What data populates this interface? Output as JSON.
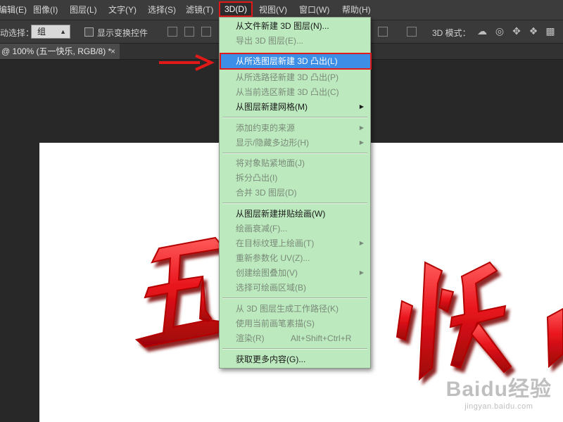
{
  "menubar": {
    "items": [
      {
        "label": "编辑(E)"
      },
      {
        "label": "图像(I)"
      },
      {
        "label": "图层(L)"
      },
      {
        "label": "文字(Y)"
      },
      {
        "label": "选择(S)"
      },
      {
        "label": "滤镜(T)"
      },
      {
        "label": "3D(D)"
      },
      {
        "label": "视图(V)"
      },
      {
        "label": "窗口(W)"
      },
      {
        "label": "帮助(H)"
      }
    ]
  },
  "options_bar": {
    "auto_select_label": "自动选择：",
    "auto_select_value": "组",
    "show_transform_label": "显示变换控件",
    "mode_label": "3D 模式："
  },
  "document_tab": {
    "title": "@ 100% (五一快乐, RGB/8) *"
  },
  "menu_3d": {
    "items": [
      {
        "label": "从文件新建 3D 图层(N)...",
        "enabled": true,
        "submenu": false
      },
      {
        "label": "导出 3D 图层(E)...",
        "enabled": false,
        "submenu": false
      },
      {
        "label": "从所选图层新建 3D 凸出(L)",
        "enabled": true,
        "submenu": false,
        "highlighted": true
      },
      {
        "label": "从所选路径新建 3D 凸出(P)",
        "enabled": false,
        "submenu": false
      },
      {
        "label": "从当前选区新建 3D 凸出(C)",
        "enabled": false,
        "submenu": false
      },
      {
        "label": "从图层新建网格(M)",
        "enabled": true,
        "submenu": true
      },
      {
        "label": "添加约束的来源",
        "enabled": false,
        "submenu": true
      },
      {
        "label": "显示/隐藏多边形(H)",
        "enabled": false,
        "submenu": true
      },
      {
        "label": "将对象贴紧地面(J)",
        "enabled": false,
        "submenu": false
      },
      {
        "label": "拆分凸出(I)",
        "enabled": false,
        "submenu": false
      },
      {
        "label": "合并 3D 图层(D)",
        "enabled": false,
        "submenu": false
      },
      {
        "label": "从图层新建拼贴绘画(W)",
        "enabled": true,
        "submenu": false
      },
      {
        "label": "绘画衰减(F)...",
        "enabled": false,
        "submenu": false
      },
      {
        "label": "在目标纹理上绘画(T)",
        "enabled": false,
        "submenu": true
      },
      {
        "label": "重新参数化 UV(Z)...",
        "enabled": false,
        "submenu": false
      },
      {
        "label": "创建绘图叠加(V)",
        "enabled": false,
        "submenu": true
      },
      {
        "label": "选择可绘画区域(B)",
        "enabled": false,
        "submenu": false
      },
      {
        "label": "从 3D 图层生成工作路径(K)",
        "enabled": false,
        "submenu": false
      },
      {
        "label": "使用当前画笔素描(S)",
        "enabled": false,
        "submenu": false
      },
      {
        "label": "渲染(R)",
        "enabled": false,
        "submenu": false,
        "shortcut": "Alt+Shift+Ctrl+R"
      },
      {
        "label": "获取更多内容(G)...",
        "enabled": true,
        "submenu": false
      }
    ]
  },
  "canvas": {
    "artwork_text": "五一快乐",
    "watermark": {
      "brand": "Baidu经验",
      "url": "jingyan.baidu.com"
    }
  },
  "colors": {
    "menu_bg": "#bce9bd",
    "highlight": "#3d8ee6",
    "annotation_red": "#e11919",
    "artwork_red": "#e8141c"
  }
}
